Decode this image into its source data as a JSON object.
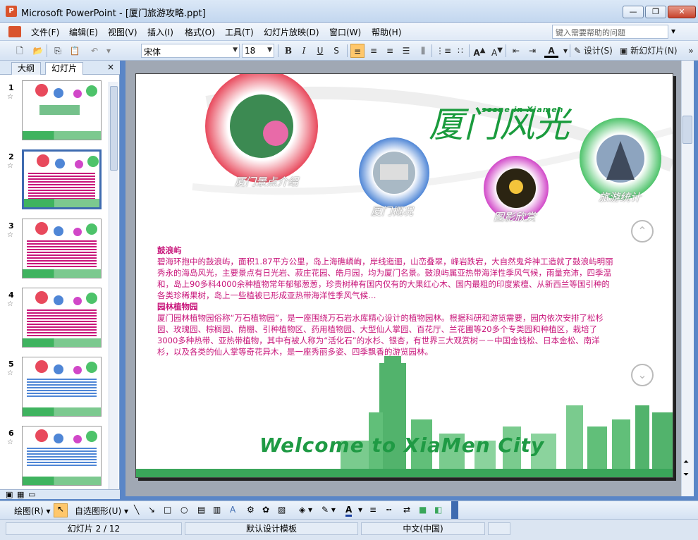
{
  "window": {
    "title": "Microsoft PowerPoint - [厦门旅游攻略.ppt]",
    "app_icon": "P",
    "minimize": "—",
    "restore": "❐",
    "close": "✕"
  },
  "menu": {
    "items": [
      "文件(F)",
      "编辑(E)",
      "视图(V)",
      "插入(I)",
      "格式(O)",
      "工具(T)",
      "幻灯片放映(D)",
      "窗口(W)",
      "帮助(H)"
    ],
    "help_placeholder": "键入需要帮助的问题",
    "close": "×"
  },
  "toolbar": {
    "font": "宋体",
    "size": "18",
    "bold": "B",
    "italic": "I",
    "underline": "U",
    "shadow": "S",
    "design": "设计(S)",
    "new_slide": "新幻灯片(N)"
  },
  "pane": {
    "tabs": [
      "大纲",
      "幻灯片"
    ],
    "close": "×",
    "slides": [
      {
        "num": "1",
        "star": "☆",
        "type": "title"
      },
      {
        "num": "2",
        "star": "☆",
        "type": "text"
      },
      {
        "num": "3",
        "star": "☆",
        "type": "text"
      },
      {
        "num": "4",
        "star": "☆",
        "type": "text"
      },
      {
        "num": "5",
        "star": "☆",
        "type": "photo"
      },
      {
        "num": "6",
        "star": "☆",
        "type": "photo"
      }
    ],
    "selected_slide": 2
  },
  "slide": {
    "title": "厦门风光",
    "subtitle": "scene in Xiamen",
    "circles": {
      "intro": "厦门景点介绍",
      "overview": "厦门概况",
      "gallery": "图影欣赏",
      "stats": "旅游统计"
    },
    "section1_head": "鼓浪屿",
    "section1_body": "碧海环抱中的鼓浪屿，面积1.87平方公里，岛上海礁嶙峋，岸线迤逦，山峦叠翠，峰岩跌宕，大自然鬼斧神工造就了鼓浪屿明丽秀永的海岛风光，主要景点有日光岩、菽庄花园、皓月园，均为厦门名景。鼓浪屿属亚热带海洋性季风气候，雨量充沛，四季温和，岛上90多科4000余种植物常年郁郁葱葱，珍贵树种有国内仅有的大果红心木、国内最粗的印度紫檀、从新西兰等国引种的各类珍稀果树，岛上一些植被已形成亚热带海洋性季风气候…",
    "section2_head": "园林植物园",
    "section2_body": "厦门园林植物园俗称“万石植物园”，是一座围绕万石岩水库精心设计的植物园林。根据科研和游览需要，园内依次安排了松杉园、玫瑰园、棕榈园、荫棚、引种植物区、药用植物园、大型仙人掌园、百花厅、兰花圃等20多个专类园和种植区，栽培了3000多种热带、亚热带植物，其中有被人称为“活化石”的水杉、银杏，有世界三大观赏树－－中国金钱松、日本金松、南洋杉，以及各类的仙人掌等奇花异木，是一座秀丽多姿、四季飘香的游览园林。",
    "welcome": "Welcome to XiaMen City",
    "nav_up": "⌃",
    "nav_down": "⌄"
  },
  "drawbar": {
    "draw": "绘图(R)",
    "autoshape": "自选图形(U)"
  },
  "status": {
    "slide_info": "幻灯片 2 / 12",
    "template": "默认设计模板",
    "language": "中文(中国)"
  },
  "colors": {
    "accent_pink": "#c8157a",
    "accent_green": "#1a9b3d"
  }
}
